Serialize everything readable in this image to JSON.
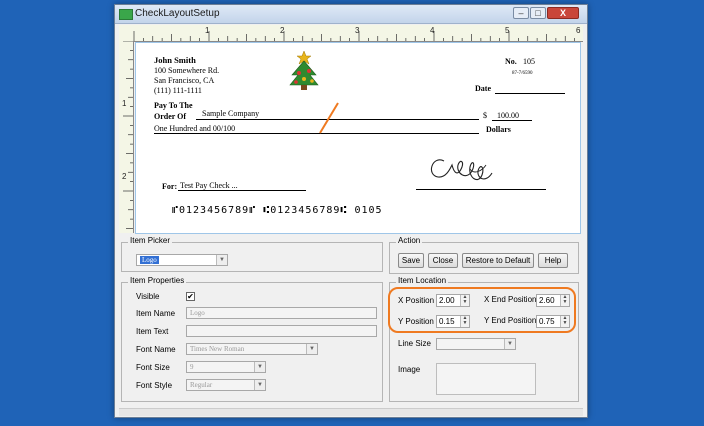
{
  "window": {
    "title": "CheckLayoutSetup",
    "min_label": "–",
    "max_label": "□",
    "close_label": "X"
  },
  "ruler": {
    "top_marks": [
      "1",
      "2",
      "3",
      "4",
      "5",
      "6"
    ],
    "left_marks": [
      "1",
      "2"
    ]
  },
  "check": {
    "payer_name": "John Smith",
    "payer_address1": "100 Somewhere Rd.",
    "payer_address2": "San Francisco, CA",
    "payer_phone": "(111) 111-1111",
    "no_label": "No.",
    "check_number": "105",
    "routing_fraction": "87-7/6590",
    "date_label": "Date",
    "pay_to_label1": "Pay To The",
    "pay_to_label2": "Order Of",
    "payee": "Sample Company",
    "dollar_sign": "$",
    "amount": "100.00",
    "amount_words": "One Hundred  and 00/100",
    "dollars_label": "Dollars",
    "for_label": "For:",
    "memo": "Test Pay Check ...",
    "micr_line": "⑈0123456789⑈ ⑆0123456789⑆  0105",
    "logo_icon": "christmas-tree-logo-icon",
    "signature_icon": "signature-icon"
  },
  "item_picker": {
    "title": "Item Picker",
    "selected": "Logo"
  },
  "action": {
    "title": "Action",
    "save": "Save",
    "close": "Close",
    "restore": "Restore to Default",
    "help": "Help"
  },
  "item_properties": {
    "title": "Item Properties",
    "visible_label": "Visible",
    "visible_checked": "✔",
    "item_name_label": "Item Name",
    "item_name_value": "Logo",
    "item_text_label": "Item Text",
    "item_text_value": "",
    "font_name_label": "Font Name",
    "font_name_value": "Times New Roman",
    "font_size_label": "Font Size",
    "font_size_value": "9",
    "font_style_label": "Font Style",
    "font_style_value": "Regular"
  },
  "item_location": {
    "title": "Item Location",
    "x_pos_label": "X Position",
    "x_pos_value": "2.00",
    "x_end_label": "X End Position",
    "x_end_value": "2.60",
    "y_pos_label": "Y Position",
    "y_pos_value": "0.15",
    "y_end_label": "Y End Position",
    "y_end_value": "0.75",
    "line_size_label": "Line Size",
    "image_label": "Image"
  },
  "colors": {
    "desktop": "#1f63b7",
    "highlight": "#ef7a21"
  }
}
